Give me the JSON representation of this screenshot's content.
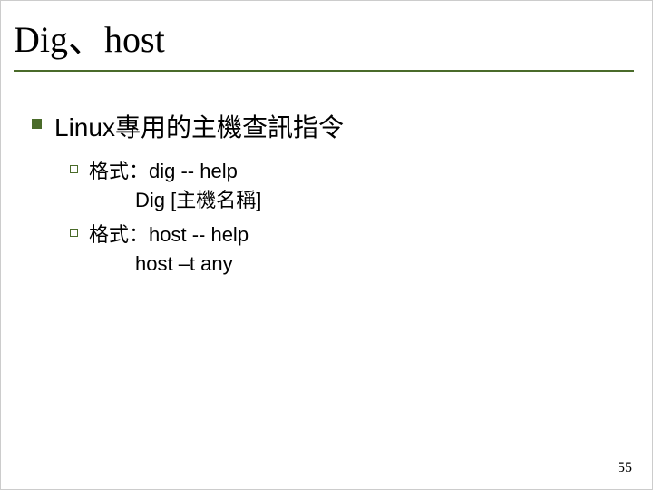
{
  "title": "Dig、host",
  "main_bullet": "Linux專用的主機查訊指令",
  "sub": [
    {
      "line1": "格式：dig -- help",
      "line2": "Dig [主機名稱]"
    },
    {
      "line1": "格式：host -- help",
      "line2": "host –t any"
    }
  ],
  "page_number": "55"
}
